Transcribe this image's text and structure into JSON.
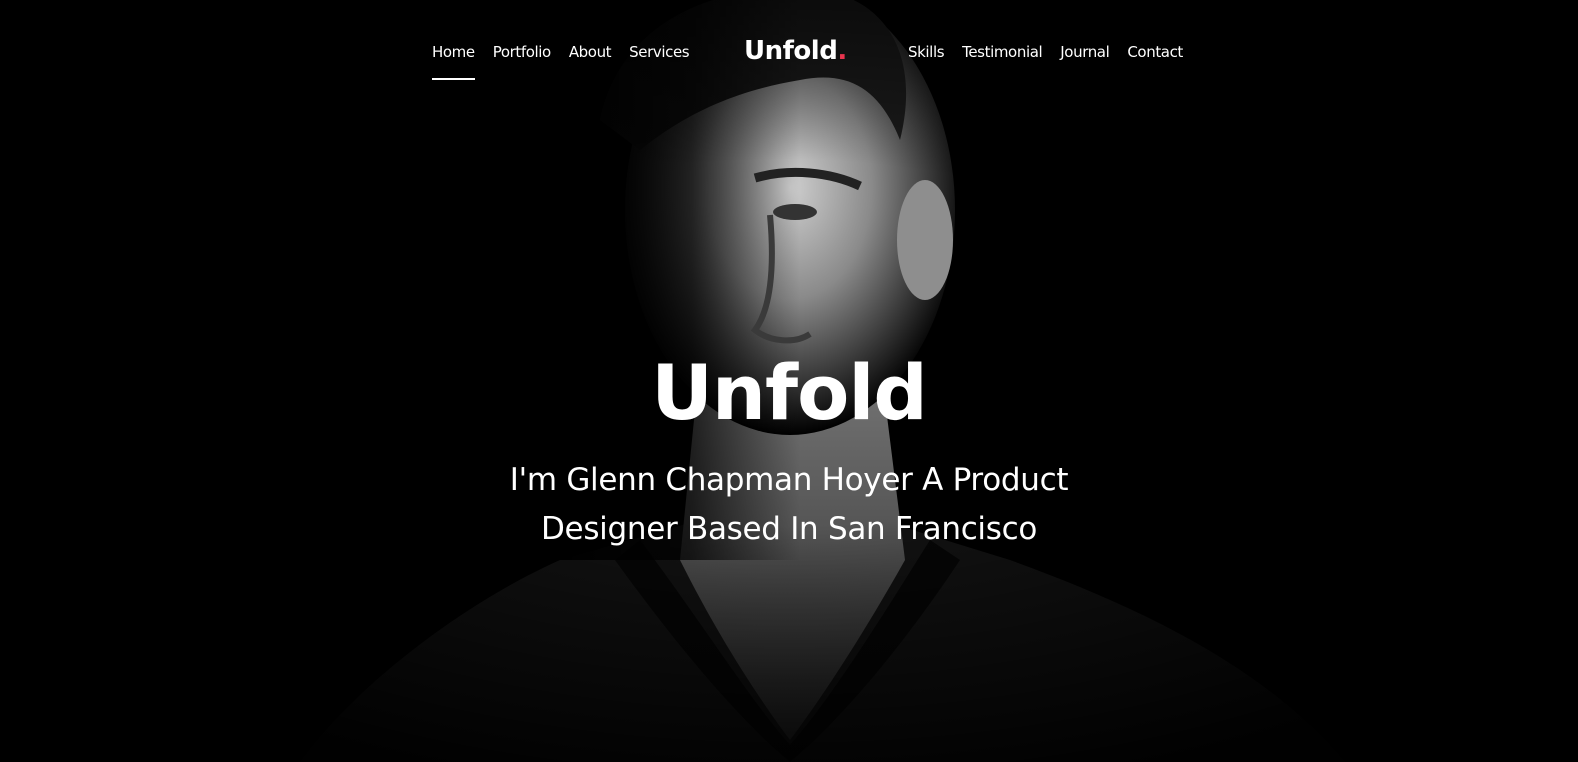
{
  "nav": {
    "left": [
      "Home",
      "Portfolio",
      "About",
      "Services"
    ],
    "right": [
      "Skills",
      "Testimonial",
      "Journal",
      "Contact"
    ],
    "active": "Home"
  },
  "brand": {
    "name": "Unfold",
    "dot": ".",
    "dot_color": "#e8344e"
  },
  "hero": {
    "title": "Unfold",
    "subtitle": "I'm Glenn Chapman Hoyer A Product Designer Based In San Francisco",
    "image": "black-and-white-portrait-man"
  }
}
